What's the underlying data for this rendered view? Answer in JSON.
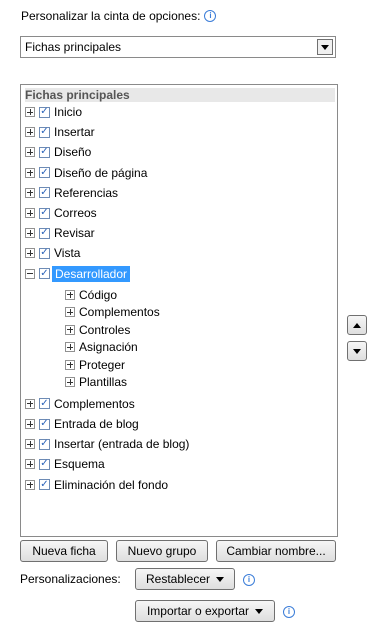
{
  "header": {
    "label": "Personalizar la cinta de opciones:",
    "info_icon": "info-icon"
  },
  "combo": {
    "value": "Fichas principales",
    "icon": "chevron-down-icon"
  },
  "tree": {
    "header": "Fichas principales",
    "items": [
      {
        "label": "Inicio",
        "checked": true,
        "expanded": false
      },
      {
        "label": "Insertar",
        "checked": true,
        "expanded": false
      },
      {
        "label": "Diseño",
        "checked": true,
        "expanded": false
      },
      {
        "label": "Diseño de página",
        "checked": true,
        "expanded": false
      },
      {
        "label": "Referencias",
        "checked": true,
        "expanded": false
      },
      {
        "label": "Correos",
        "checked": true,
        "expanded": false
      },
      {
        "label": "Revisar",
        "checked": true,
        "expanded": false
      },
      {
        "label": "Vista",
        "checked": true,
        "expanded": false
      },
      {
        "label": "Desarrollador",
        "checked": true,
        "expanded": true,
        "selected": true,
        "children": [
          "Código",
          "Complementos",
          "Controles",
          "Asignación",
          "Proteger",
          "Plantillas"
        ]
      },
      {
        "label": "Complementos",
        "checked": true,
        "expanded": false
      },
      {
        "label": "Entrada de blog",
        "checked": true,
        "expanded": false
      },
      {
        "label": "Insertar (entrada de blog)",
        "checked": true,
        "expanded": false
      },
      {
        "label": "Esquema",
        "checked": true,
        "expanded": false
      },
      {
        "label": "Eliminación del fondo",
        "checked": true,
        "expanded": false
      }
    ]
  },
  "side_buttons": {
    "up_icon": "arrow-up-icon",
    "down_icon": "arrow-down-icon"
  },
  "buttons": {
    "new_tab": "Nueva ficha",
    "new_group": "Nuevo grupo",
    "rename": "Cambiar nombre..."
  },
  "customizations": {
    "label": "Personalizaciones:",
    "reset": "Restablecer",
    "import_export": "Importar o exportar"
  }
}
